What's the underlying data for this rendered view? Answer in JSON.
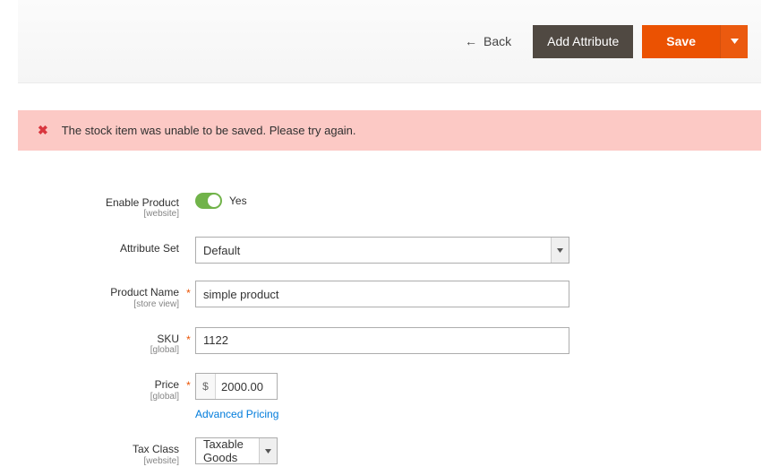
{
  "header": {
    "back_label": "Back",
    "add_attribute_label": "Add Attribute",
    "save_label": "Save"
  },
  "alert": {
    "message": "The stock item was unable to be saved. Please try again."
  },
  "form": {
    "enable_product": {
      "label": "Enable Product",
      "scope": "[website]",
      "value_label": "Yes",
      "checked": true
    },
    "attribute_set": {
      "label": "Attribute Set",
      "value": "Default"
    },
    "product_name": {
      "label": "Product Name",
      "scope": "[store view]",
      "value": "simple product"
    },
    "sku": {
      "label": "SKU",
      "scope": "[global]",
      "value": "1122"
    },
    "price": {
      "label": "Price",
      "scope": "[global]",
      "currency": "$",
      "value": "2000.00",
      "advanced_link": "Advanced Pricing"
    },
    "tax_class": {
      "label": "Tax Class",
      "scope": "[website]",
      "value": "Taxable Goods"
    }
  }
}
